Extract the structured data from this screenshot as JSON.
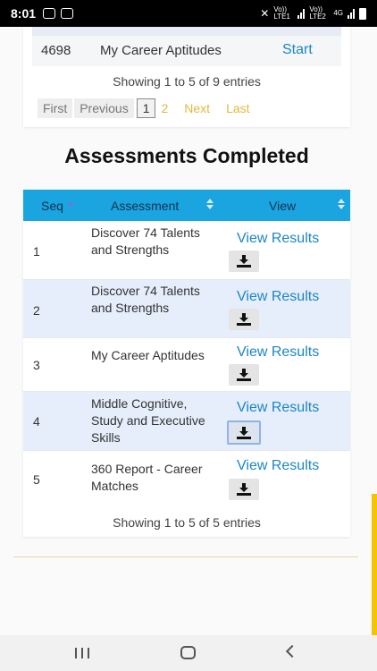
{
  "status_bar": {
    "time": "8:01",
    "sim1_label": "Vo)) LTE1",
    "sim2_label": "Vo)) LTE2",
    "network": "4G"
  },
  "top_table": {
    "row": {
      "id": "4698",
      "name": "My Career Aptitudes",
      "action": "Start"
    },
    "info": "Showing 1 to 5 of 9 entries",
    "pagination": {
      "first": "First",
      "previous": "Previous",
      "current": "1",
      "page2": "2",
      "next": "Next",
      "last": "Last"
    }
  },
  "completed": {
    "title": "Assessments Completed",
    "headers": {
      "seq": "Seq",
      "assessment": "Assessment",
      "view": "View"
    },
    "rows": [
      {
        "seq": "1",
        "name": "Discover 74 Talents and Strengths",
        "link": "View Results"
      },
      {
        "seq": "2",
        "name": "Discover 74 Talents and Strengths",
        "link": "View Results"
      },
      {
        "seq": "3",
        "name": "My Career Aptitudes",
        "link": "View Results"
      },
      {
        "seq": "4",
        "name": "Middle Cognitive, Study and Executive Skills",
        "link": "View Results"
      },
      {
        "seq": "5",
        "name": "360 Report - Career Matches",
        "link": "View Results"
      }
    ],
    "info": "Showing 1 to 5 of 5 entries"
  },
  "colors": {
    "header_bg": "#1aa5e1",
    "link": "#1a86c7",
    "pager_link": "#e2b93b",
    "alt_row": "#e6eefb",
    "scroll_indicator": "#f4c400"
  },
  "icons": {
    "download": "download-icon",
    "sort": "sort-icon"
  }
}
